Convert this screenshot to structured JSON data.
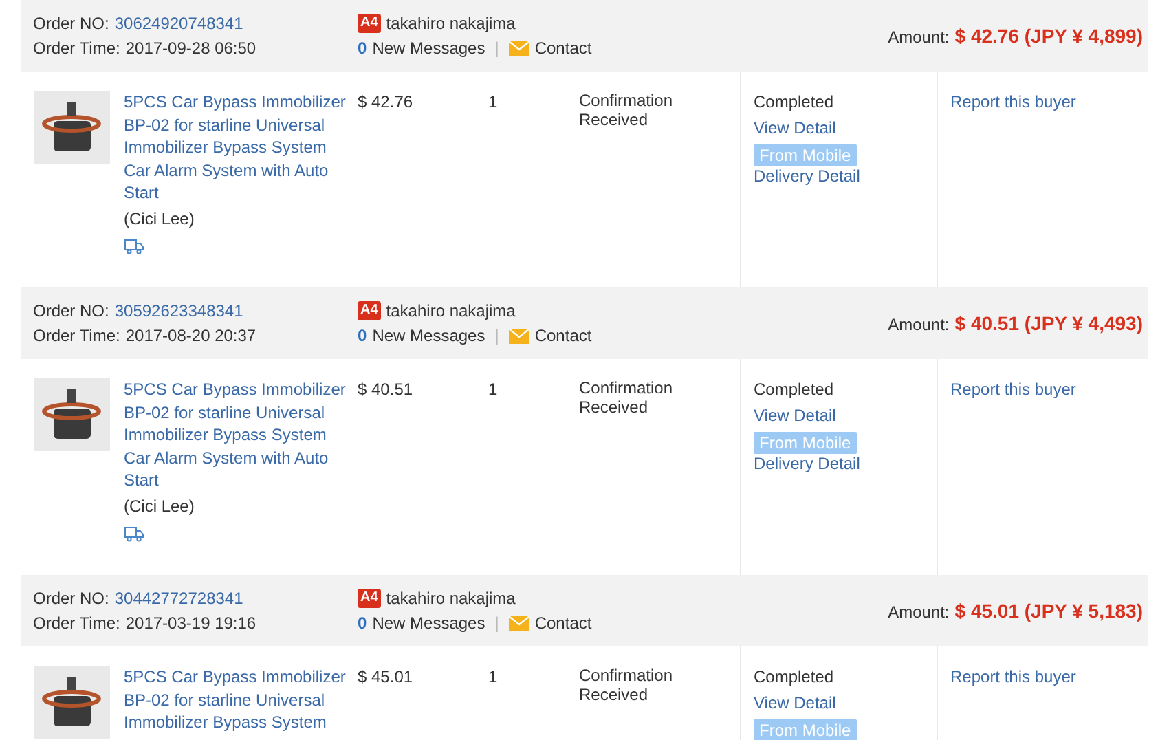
{
  "orders": [
    {
      "order_no_label": "Order NO:",
      "order_no": "30624920748341",
      "order_time_label": "Order Time:",
      "order_time": "2017-09-28 06:50",
      "buyer_badge": "A4",
      "buyer": "takahiro nakajima",
      "message_count": "0",
      "messages_label": "New Messages",
      "separator": "|",
      "contact": "Contact",
      "amount_label": "Amount:",
      "amount": "$ 42.76 (JPY ¥ 4,899)",
      "item": {
        "title": "5PCS Car Bypass Immobilizer BP-02 for starline Universal Immobilizer Bypass System Car Alarm System with Auto Start",
        "seller": "(Cici Lee)",
        "shipping_icon": true,
        "price": "$ 42.76",
        "quantity": "1",
        "status": "Confirmation Received",
        "order_status": "Completed",
        "view_detail": "View Detail",
        "mobile_badge": "From Mobile",
        "delivery_detail": "Delivery Detail",
        "report": "Report this buyer"
      }
    },
    {
      "order_no_label": "Order NO:",
      "order_no": "30592623348341",
      "order_time_label": "Order Time:",
      "order_time": "2017-08-20 20:37",
      "buyer_badge": "A4",
      "buyer": "takahiro nakajima",
      "message_count": "0",
      "messages_label": "New Messages",
      "separator": "|",
      "contact": "Contact",
      "amount_label": "Amount:",
      "amount": "$ 40.51 (JPY ¥ 4,493)",
      "item": {
        "title": "5PCS Car Bypass Immobilizer BP-02 for starline Universal Immobilizer Bypass System Car Alarm System with Auto Start",
        "seller": "(Cici Lee)",
        "shipping_icon": true,
        "price": "$ 40.51",
        "quantity": "1",
        "status": "Confirmation Received",
        "order_status": "Completed",
        "view_detail": "View Detail",
        "mobile_badge": "From Mobile",
        "delivery_detail": "Delivery Detail",
        "report": "Report this buyer"
      }
    },
    {
      "order_no_label": "Order NO:",
      "order_no": "30442772728341",
      "order_time_label": "Order Time:",
      "order_time": "2017-03-19 19:16",
      "buyer_badge": "A4",
      "buyer": "takahiro nakajima",
      "message_count": "0",
      "messages_label": "New Messages",
      "separator": "|",
      "contact": "Contact",
      "amount_label": "Amount:",
      "amount": "$ 45.01 (JPY ¥ 5,183)",
      "item": {
        "title": "5PCS Car Bypass Immobilizer BP-02 for starline Universal Immobilizer Bypass System",
        "shipping_icon": false,
        "price": "$ 45.01",
        "quantity": "1",
        "status": "Confirmation Received",
        "order_status": "Completed",
        "view_detail": "View Detail",
        "mobile_badge": "From Mobile",
        "report": "Report this buyer"
      }
    }
  ]
}
